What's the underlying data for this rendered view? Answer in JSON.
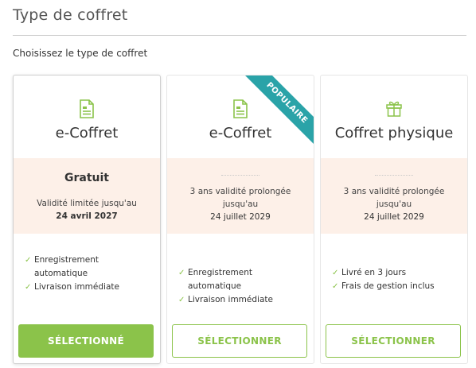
{
  "header": {
    "title": "Type de coffret",
    "subtitle": "Choisissez le type de coffret"
  },
  "colors": {
    "accent": "#8bc34a",
    "ribbon": "#2aa3a8",
    "price_bg": "#fdf0e8"
  },
  "cards": [
    {
      "icon": "document-icon",
      "name": "e-Coffret",
      "price": "Gratuit",
      "validity": "Validité limitée jusqu'au",
      "validity_date": "24 avril 2027",
      "features": [
        "Enregistrement automatique",
        "Livraison immédiate"
      ],
      "button_label": "SÉLECTIONNÉ",
      "selected": true
    },
    {
      "icon": "document-icon",
      "name": "e-Coffret",
      "ribbon": "POPULAIRE",
      "validity": "3 ans validité prolongée jusqu'au",
      "validity_date": "24 juillet 2029",
      "features": [
        "Enregistrement automatique",
        "Livraison immédiate"
      ],
      "button_label": "SÉLECTIONNER",
      "selected": false
    },
    {
      "icon": "gift-icon",
      "name": "Coffret physique",
      "validity": "3 ans validité prolongée jusqu'au",
      "validity_date": "24 juillet 2029",
      "features": [
        "Livré en 3 jours",
        "Frais de gestion inclus"
      ],
      "button_label": "SÉLECTIONNER",
      "selected": false
    }
  ]
}
